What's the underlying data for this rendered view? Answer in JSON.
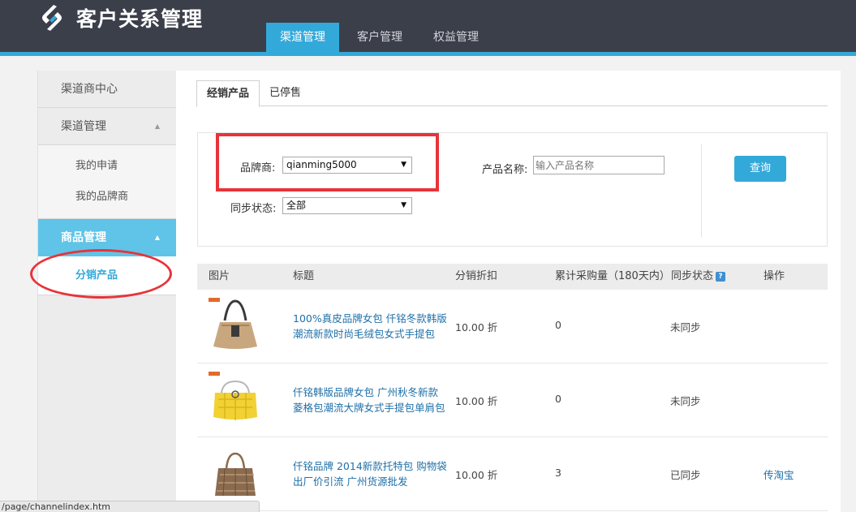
{
  "app": {
    "title": "客户关系管理"
  },
  "nav": {
    "tabs": [
      "渠道管理",
      "客户管理",
      "权益管理"
    ],
    "active": "渠道管理"
  },
  "sidebar": {
    "channel_center": "渠道商中心",
    "channel_mgmt": "渠道管理",
    "channel_sub": [
      "我的申请",
      "我的品牌商"
    ],
    "goods_mgmt": "商品管理",
    "goods_sub": [
      "分销产品"
    ]
  },
  "tabs": [
    "经销产品",
    "已停售"
  ],
  "filter": {
    "brand_label": "品牌商:",
    "brand_value": "qianming5000",
    "sync_label": "同步状态:",
    "sync_value": "全部",
    "product_label": "产品名称:",
    "product_placeholder": "输入产品名称",
    "query_button": "查询"
  },
  "table": {
    "headers": [
      "图片",
      "标题",
      "分销折扣",
      "累计采购量（180天内）",
      "同步状态",
      "操作"
    ],
    "help_icon_text": "?",
    "rows": [
      {
        "title": "100%真皮品牌女包 仟铭冬款韩版潮流新款时尚毛绒包女式手提包",
        "discount": "10.00 折",
        "purchases": "0",
        "sync": "未同步",
        "action": ""
      },
      {
        "title": "仟铭韩版品牌女包 广州秋冬新款菱格包潮流大牌女式手提包单肩包",
        "discount": "10.00 折",
        "purchases": "0",
        "sync": "未同步",
        "action": ""
      },
      {
        "title": "仟铭品牌 2014新款托特包 购物袋出厂价引流 广州货源批发",
        "discount": "10.00 折",
        "purchases": "3",
        "sync": "已同步",
        "action": "传淘宝"
      }
    ]
  },
  "statusbar": {
    "url": "/page/channelindex.htm"
  },
  "colors": {
    "accent": "#33a9d9",
    "header_bg": "#3b3f4a",
    "annotation_red": "#e8333a",
    "link": "#1e6fa8"
  },
  "icons": [
    "logo-icon",
    "caret-up-icon",
    "dropdown-arrow-icon",
    "help-icon",
    "product-image"
  ]
}
